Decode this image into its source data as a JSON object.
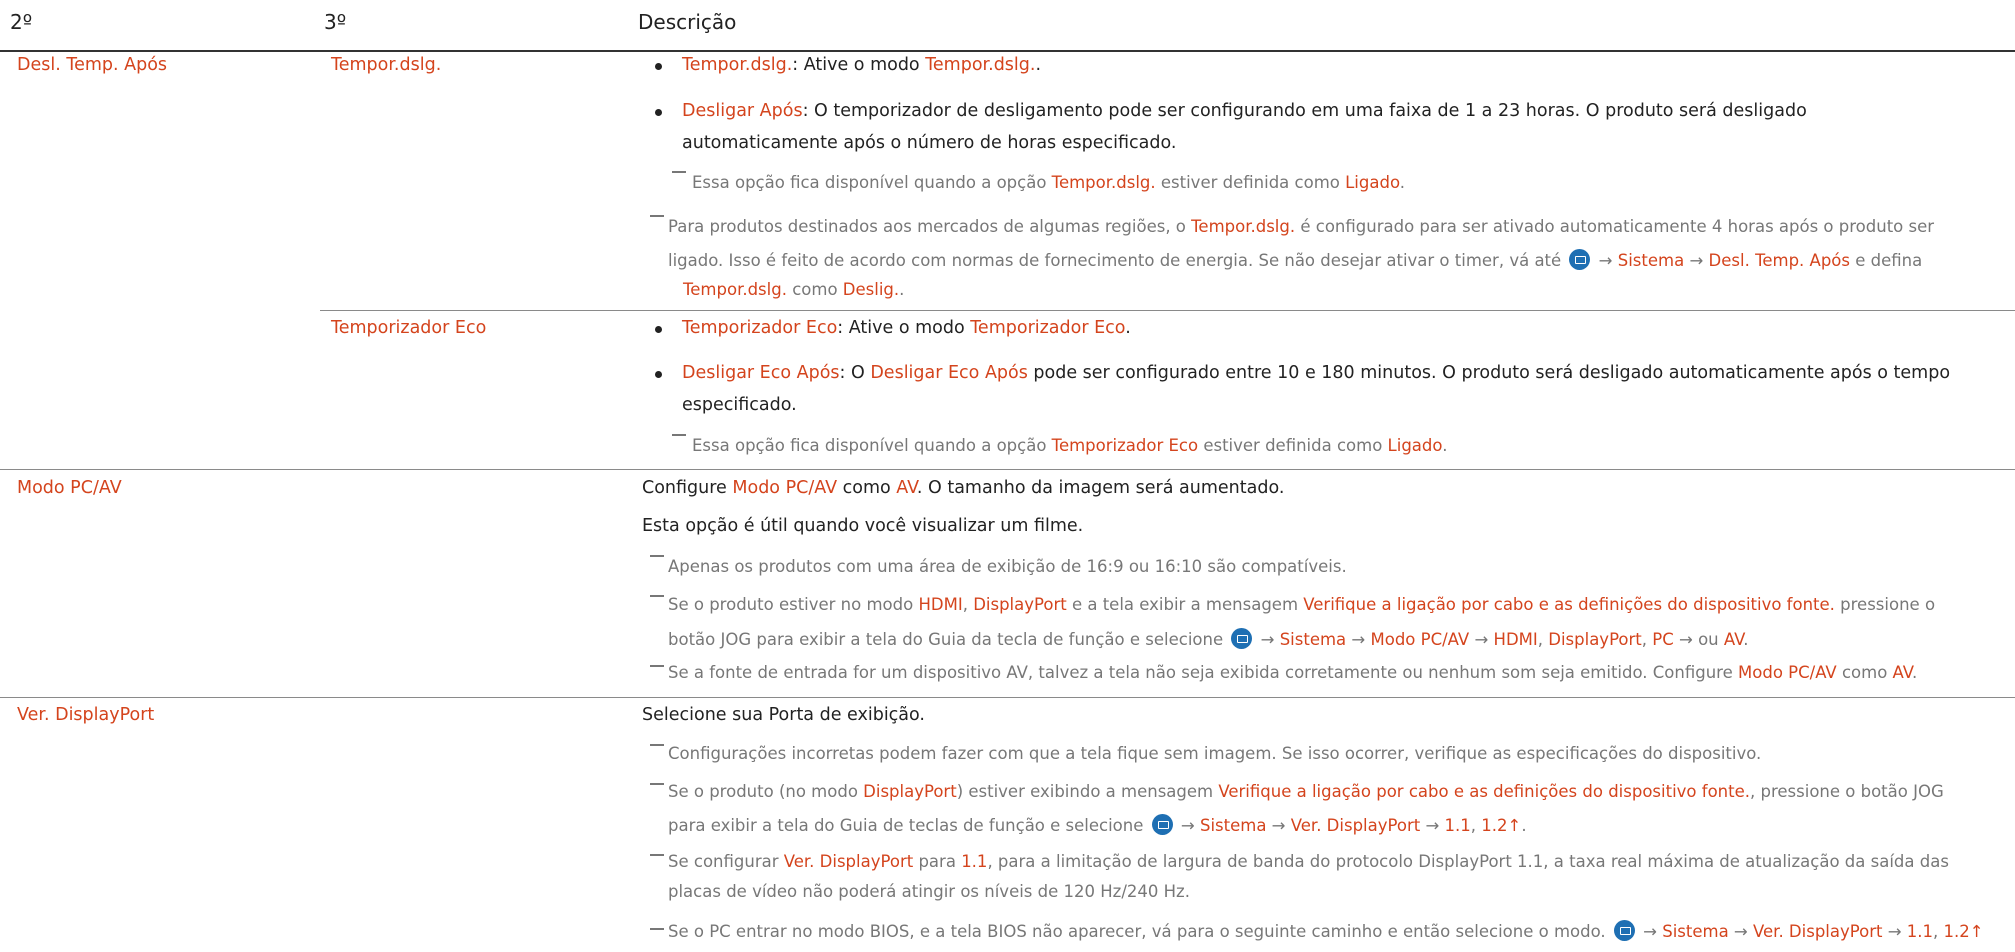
{
  "header": {
    "col2": "2º",
    "col3": "3º",
    "col_desc": "Descrição"
  },
  "sections": {
    "desl": {
      "label": "Desl. Temp. Após",
      "tempor": {
        "label": "Tempor.dslg.",
        "b1_term": "Tempor.dslg.",
        "b1_text": ": Ative o modo ",
        "b1_term2": "Tempor.dslg.",
        "b1_end": ".",
        "b2_term": "Desligar Após",
        "b2_text": ": O temporizador de desligamento pode ser configurando em uma faixa de 1 a 23 horas. O produto será desligado",
        "b2_line2": "automaticamente após o número de horas especificado.",
        "n1_text": "Essa opção fica disponível quando a opção ",
        "n1_term": "Tempor.dslg.",
        "n1_mid": " estiver definida como ",
        "n1_term2": "Ligado",
        "n1_end": ".",
        "n2_text1": "Para produtos destinados aos mercados de algumas regiões, o ",
        "n2_term": "Tempor.dslg.",
        "n2_text2": " é configurado para ser ativado automaticamente 4 horas após o produto ser",
        "n2_line2": "ligado. Isso é feito de acordo com normas de fornecimento de energia. Se não desejar ativar o timer, vá até ",
        "n2_arrow1": " → ",
        "n2_term2": "Sistema",
        "n2_arrow2": " → ",
        "n2_term3": "Desl. Temp. Após",
        "n2_and": " e defina",
        "n2_term4": "Tempor.dslg.",
        "n2_como": " como ",
        "n2_term5": "Deslig.",
        "n2_end": "."
      },
      "eco": {
        "label": "Temporizador Eco",
        "b1_term": "Temporizador Eco",
        "b1_text": ": Ative o modo ",
        "b1_term2": "Temporizador Eco",
        "b1_end": ".",
        "b2_term": "Desligar Eco Após",
        "b2_text": ": O ",
        "b2_term2": "Desligar Eco Após",
        "b2_text2": " pode ser configurado entre 10 e 180 minutos. O produto será desligado automaticamente após o tempo",
        "b2_line2": "especificado.",
        "n1_text": "Essa opção fica disponível quando a opção ",
        "n1_term": "Temporizador Eco",
        "n1_mid": " estiver definida como ",
        "n1_term2": "Ligado",
        "n1_end": "."
      }
    },
    "modo": {
      "label": "Modo PC/AV",
      "l1_text": "Configure ",
      "l1_term": "Modo PC/AV",
      "l1_mid": " como ",
      "l1_term2": "AV",
      "l1_end": ". O tamanho da imagem será aumentado.",
      "l2": "Esta opção é útil quando você visualizar um filme.",
      "n1": "Apenas os produtos com uma área de exibição de 16:9 ou 16:10 são compatíveis.",
      "n2_text": "Se o produto estiver no modo ",
      "n2_t1": "HDMI",
      "n2_comma": ", ",
      "n2_t2": "DisplayPort",
      "n2_mid": " e a tela exibir a mensagem ",
      "n2_t3": "Verifique a ligação por cabo e as definições do dispositivo fonte.",
      "n2_end": " pressione o",
      "n2_line2": "botão JOG para exibir a tela do Guia da tecla de função e selecione ",
      "n2_a1": " → ",
      "n2_t4": "Sistema",
      "n2_a2": " → ",
      "n2_t5": "Modo PC/AV",
      "n2_a3": " → ",
      "n2_t6": "HDMI",
      "n2_c1": ", ",
      "n2_t7": "DisplayPort",
      "n2_c2": ", ",
      "n2_t8": "PC",
      "n2_ou": " → ou ",
      "n2_t9": "AV",
      "n2_dot": ".",
      "n3_text": "Se a fonte de entrada for um dispositivo AV, talvez a tela não seja exibida corretamente ou nenhum som seja emitido. Configure ",
      "n3_t1": "Modo PC/AV",
      "n3_mid": " como ",
      "n3_t2": "AV",
      "n3_end": "."
    },
    "ver": {
      "label": "Ver. DisplayPort",
      "l1": "Selecione sua Porta de exibição.",
      "n1": "Configurações incorretas podem fazer com que a tela fique sem imagem. Se isso ocorrer, verifique as especificações do dispositivo.",
      "n2_text": "Se o produto (no modo ",
      "n2_t1": "DisplayPort",
      "n2_mid": ") estiver exibindo a mensagem ",
      "n2_t2": "Verifique a ligação por cabo e as definições do dispositivo fonte.",
      "n2_end": ", pressione o botão JOG",
      "n2_line2": "para exibir a tela do Guia de teclas de função e selecione ",
      "n2_a1": " → ",
      "n2_t3": "Sistema",
      "n2_a2": " → ",
      "n2_t4": "Ver. DisplayPort",
      "n2_a3": " → ",
      "n2_t5": "1.1",
      "n2_c": ", ",
      "n2_t6": "1.2↑",
      "n2_dot": ".",
      "n3_text": "Se configurar ",
      "n3_t1": "Ver. DisplayPort",
      "n3_para": " para ",
      "n3_t2": "1.1",
      "n3_end": ", para a limitação de largura de banda do protocolo DisplayPort 1.1, a taxa real máxima de atualização da saída das",
      "n3_line2": "placas de vídeo não poderá atingir os níveis de 120 Hz/240 Hz.",
      "n4_text": "Se o PC entrar no modo BIOS, e a tela BIOS não aparecer, vá para o seguinte caminho e então selecione o modo. ",
      "n4_a1": " → ",
      "n4_t1": "Sistema",
      "n4_a2": " → ",
      "n4_t2": "Ver. DisplayPort",
      "n4_a3": " → ",
      "n4_t3": "1.1",
      "n4_c": ", ",
      "n4_t4": "1.2↑"
    }
  },
  "colors": {
    "accent": "#d4441d",
    "text": "#222222",
    "note": "#777777",
    "menu_icon": "#1e6fb3"
  },
  "icons": {
    "menu": "menu-icon",
    "note_dash": "note-dash-icon",
    "bullet": "bullet-icon"
  }
}
